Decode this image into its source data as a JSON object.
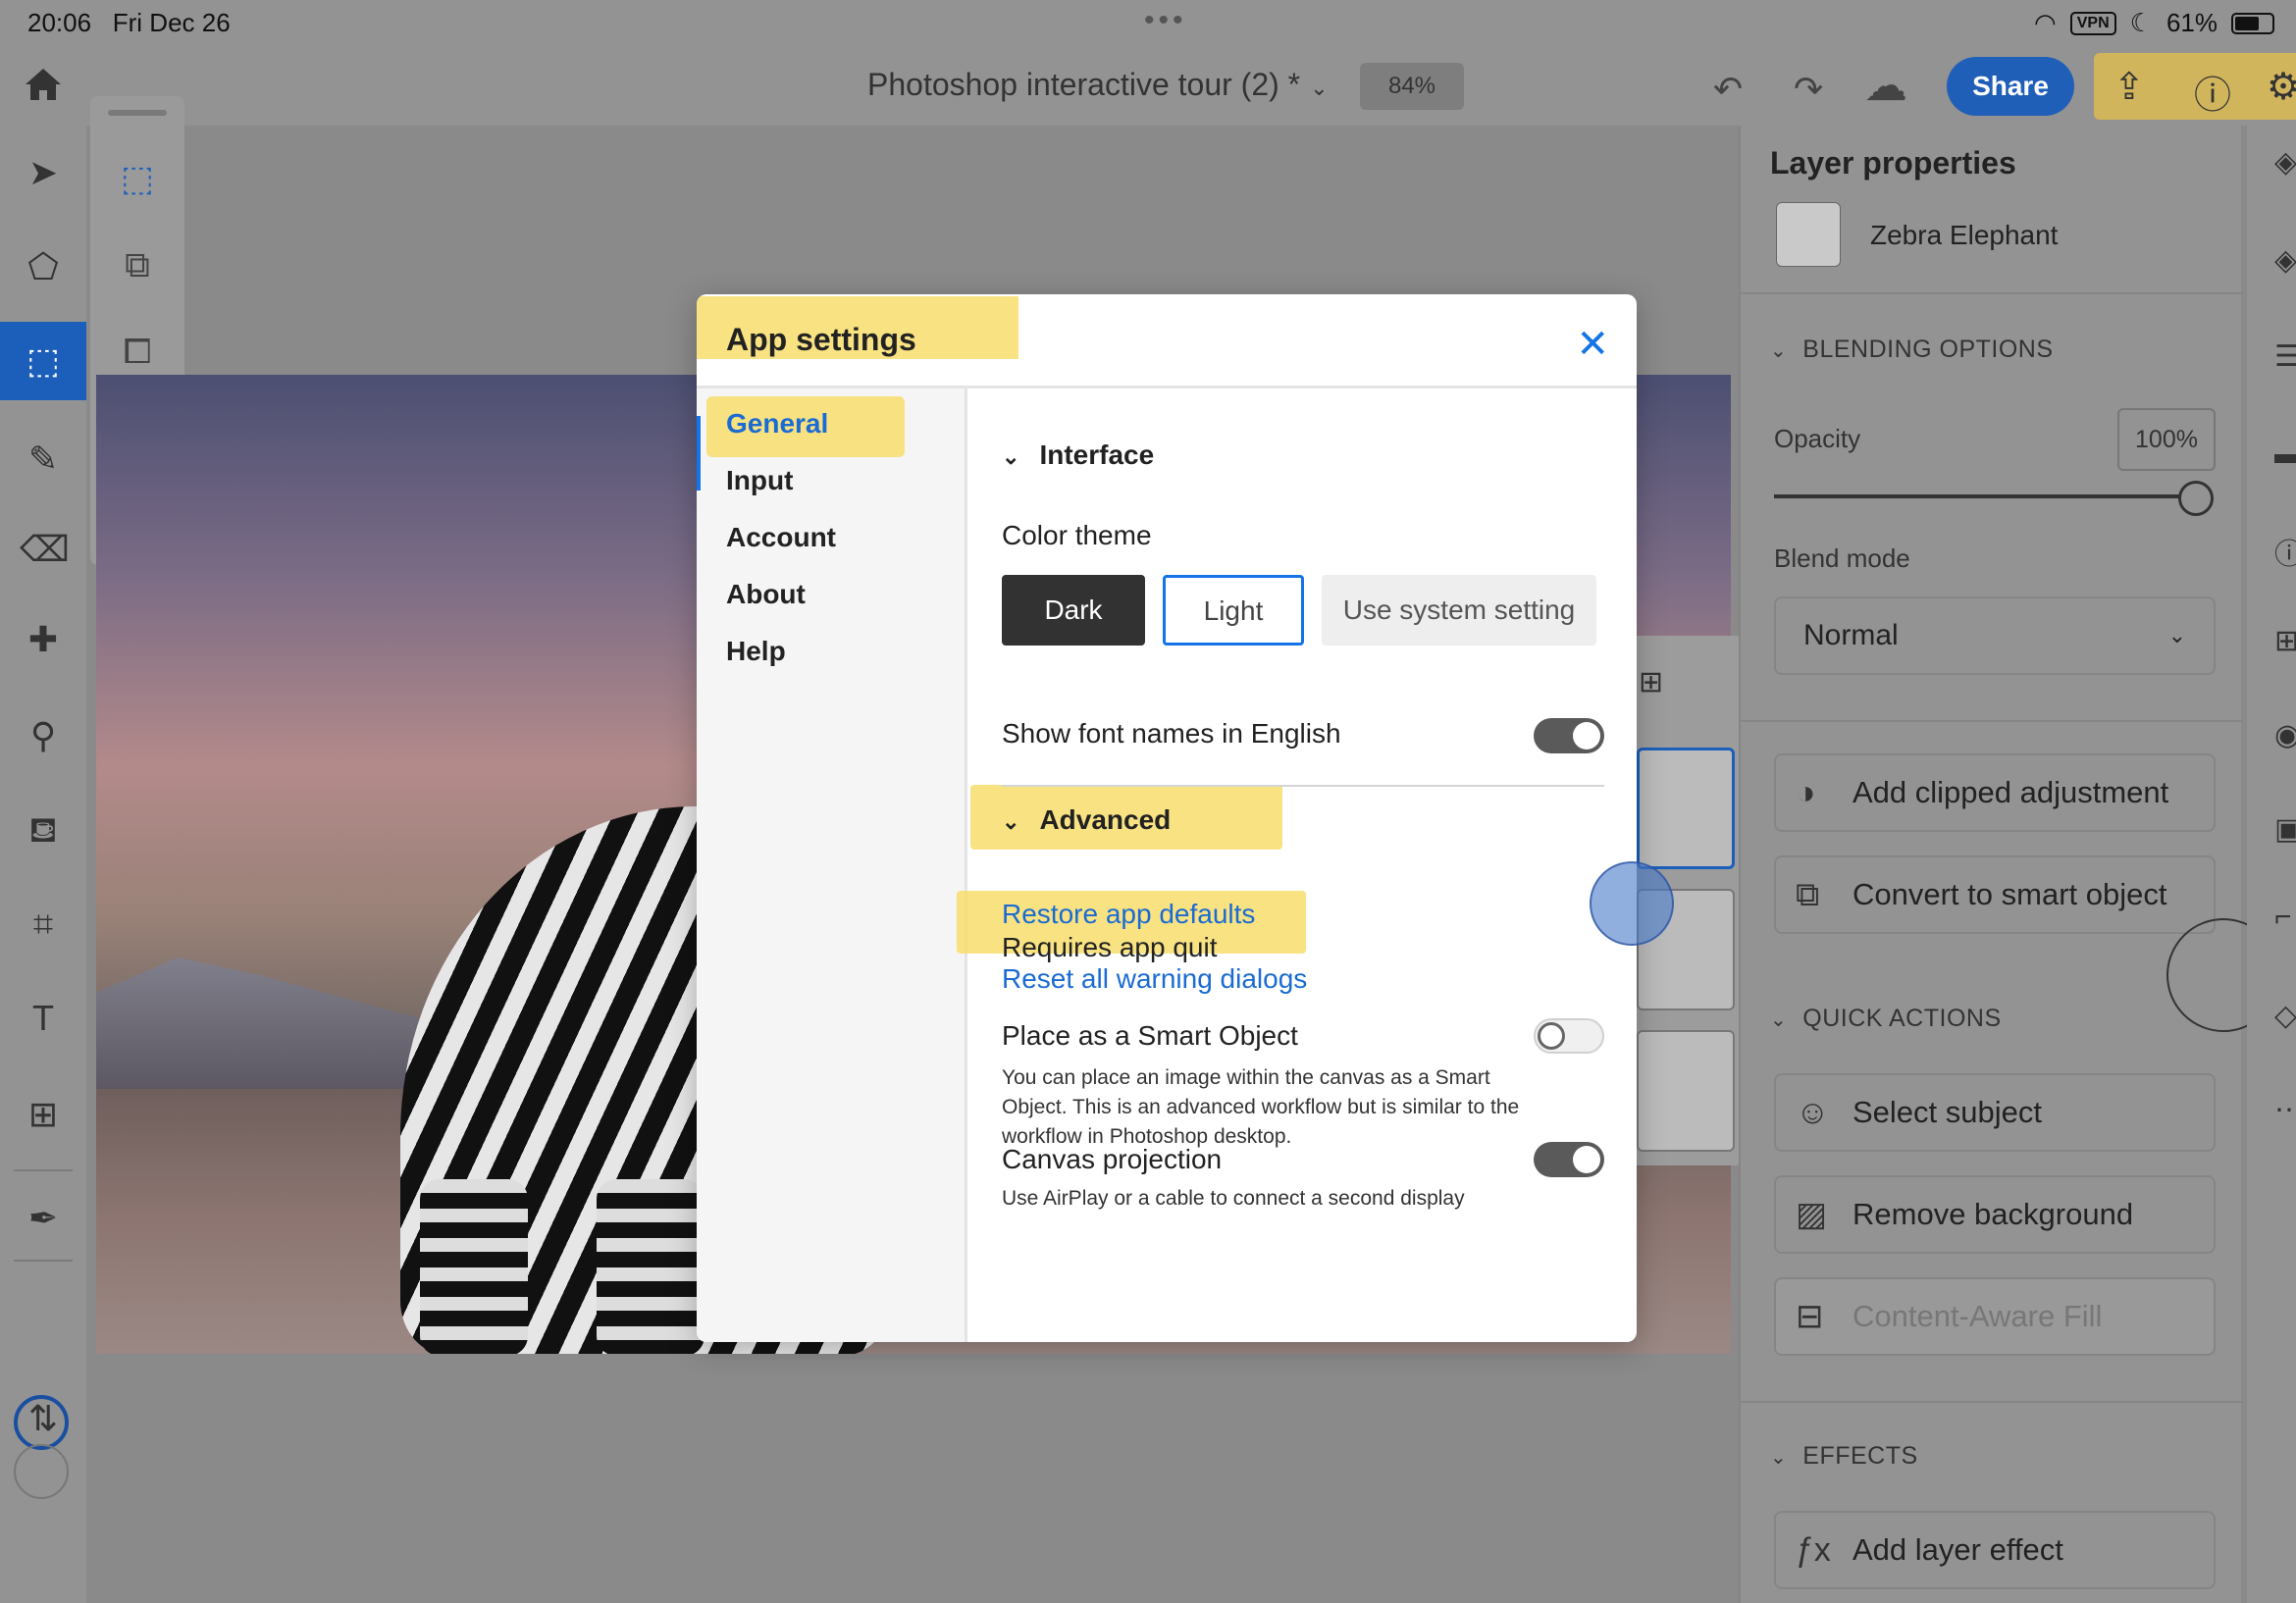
{
  "status_bar": {
    "time": "20:06",
    "date": "Fri Dec 26",
    "vpn": "VPN",
    "battery": "61%"
  },
  "app_bar": {
    "document_title": "Photoshop interactive tour (2) *",
    "zoom": "84%",
    "share_label": "Share"
  },
  "layer_properties": {
    "title": "Layer properties",
    "layer_name": "Zebra Elephant",
    "blending_section": "BLENDING OPTIONS",
    "opacity_label": "Opacity",
    "opacity_value": "100%",
    "blend_mode_label": "Blend mode",
    "blend_mode_value": "Normal",
    "add_clipped_adjustment": "Add clipped adjustment",
    "convert_smart_object": "Convert to smart object",
    "quick_actions_section": "QUICK ACTIONS",
    "select_subject": "Select subject",
    "remove_background": "Remove background",
    "content_aware_fill": "Content-Aware Fill",
    "effects_section": "EFFECTS",
    "add_layer_effect": "Add layer effect"
  },
  "dialog": {
    "title": "App settings",
    "nav": [
      {
        "label": "General",
        "active": true
      },
      {
        "label": "Input"
      },
      {
        "label": "Account"
      },
      {
        "label": "About"
      },
      {
        "label": "Help"
      }
    ],
    "interface_section": "Interface",
    "color_theme_label": "Color theme",
    "theme_options": [
      "Dark",
      "Light",
      "Use system setting"
    ],
    "theme_selected": "Light",
    "show_font_names_label": "Show font names in English",
    "show_font_names_on": true,
    "advanced_section": "Advanced",
    "restore_defaults": "Restore app defaults",
    "requires_quit": "Requires app quit",
    "reset_warnings": "Reset all warning dialogs",
    "smart_object_label": "Place as a Smart Object",
    "smart_object_on": false,
    "smart_object_desc": "You can place an image within the canvas as a Smart Object. This is an advanced workflow but is similar to the workflow in Photoshop desktop.",
    "canvas_projection_label": "Canvas projection",
    "canvas_projection_on": true,
    "canvas_projection_desc": "Use AirPlay or a cable to connect a second display"
  },
  "colors": {
    "accent": "#1473e6",
    "highlight": "#f7dd6c",
    "share": "#1f5fb8"
  }
}
